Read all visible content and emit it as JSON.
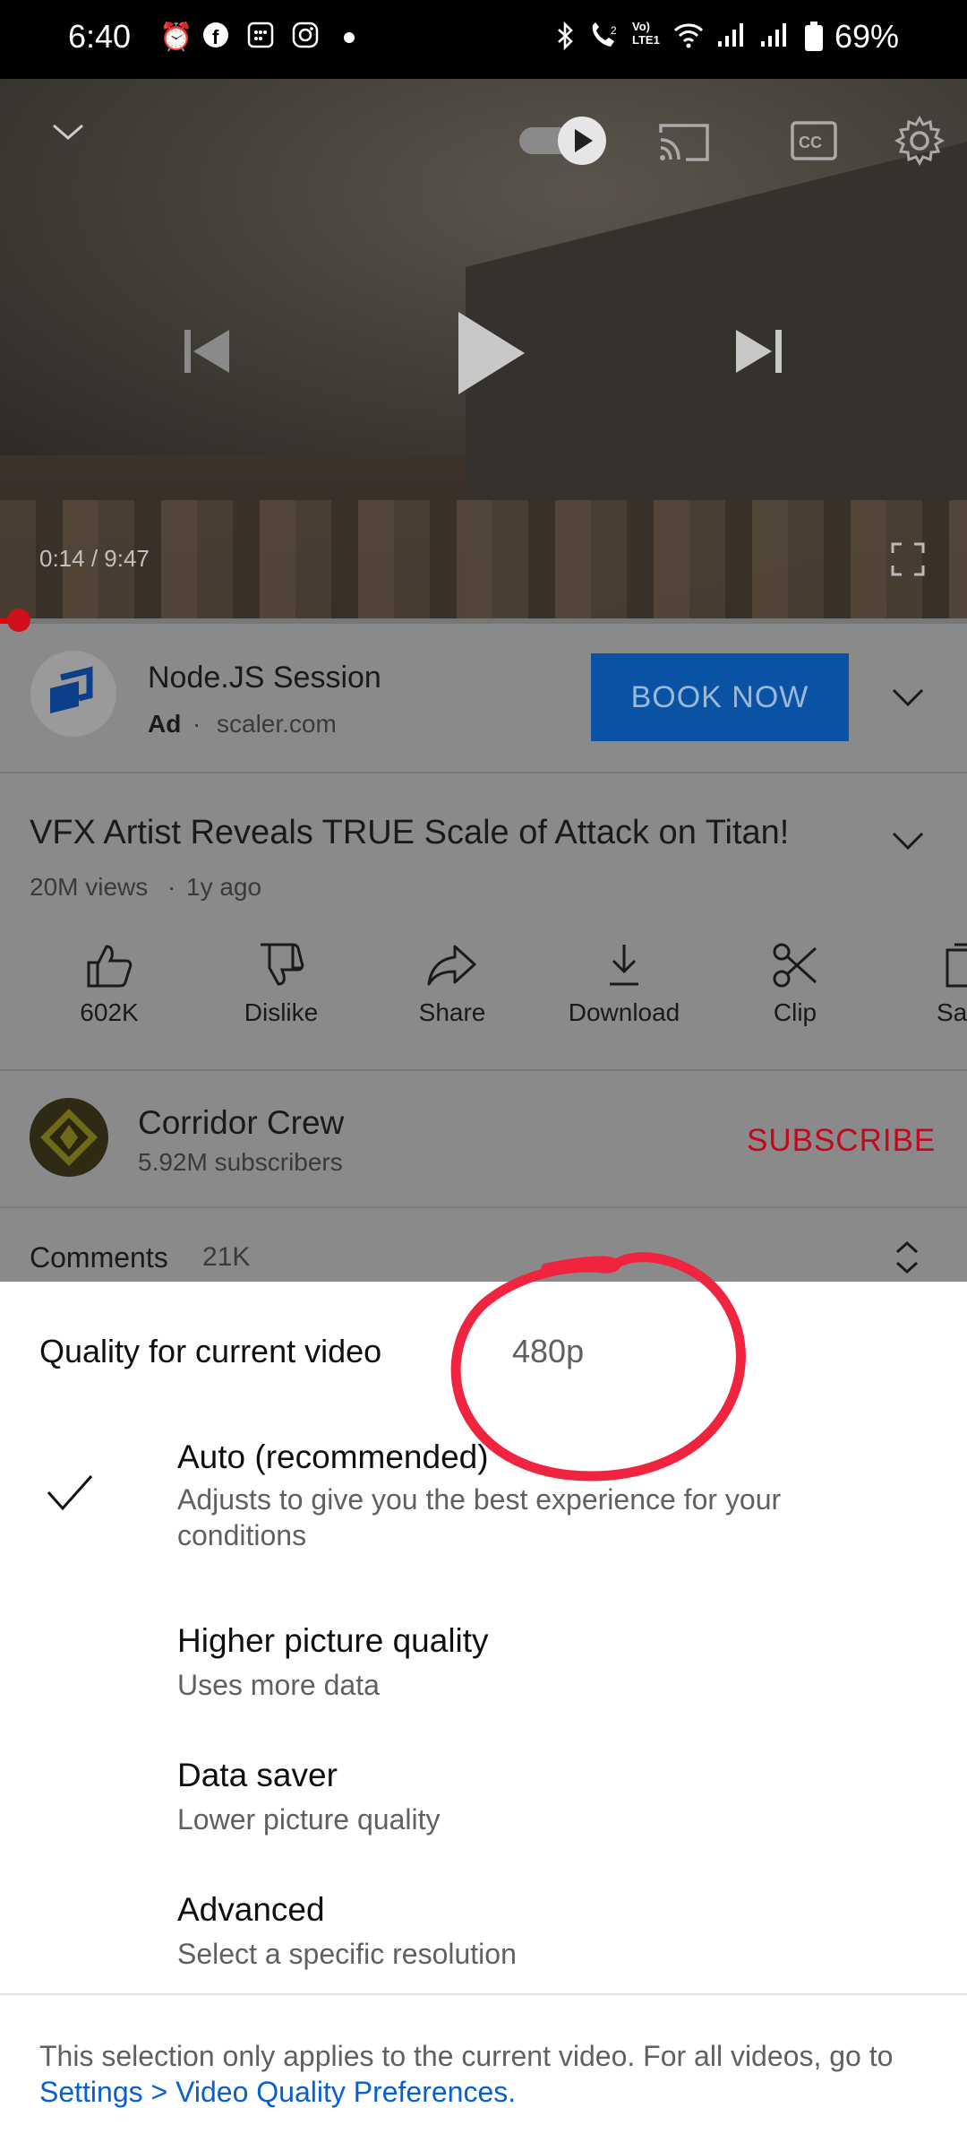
{
  "status_bar": {
    "time": "6:40",
    "battery": "69%",
    "left_icons": [
      "alarm-icon",
      "facebook-icon",
      "calendar-icon",
      "instagram-icon",
      "dot-icon"
    ],
    "right_icons": [
      "bluetooth-icon",
      "wifi-calling-icon",
      "volte-icon",
      "wifi-icon",
      "signal-icon",
      "signal-icon",
      "battery-icon"
    ]
  },
  "player": {
    "elapsed": "0:14",
    "duration": "9:47",
    "time_display": "0:14 / 9:47",
    "progress_fraction": 0.024,
    "autoplay_on": true
  },
  "ad": {
    "title": "Node.JS Session",
    "ad_label": "Ad",
    "domain": "scaler.com",
    "cta": "BOOK NOW"
  },
  "video": {
    "title": "VFX Artist Reveals TRUE Scale of Attack on Titan!",
    "views": "20M views",
    "age": "1y ago"
  },
  "actions": [
    {
      "label": "602K",
      "icon": "like-icon"
    },
    {
      "label": "Dislike",
      "icon": "dislike-icon"
    },
    {
      "label": "Share",
      "icon": "share-icon"
    },
    {
      "label": "Download",
      "icon": "download-icon"
    },
    {
      "label": "Clip",
      "icon": "clip-icon"
    },
    {
      "label": "Sa",
      "icon": "save-icon"
    }
  ],
  "channel": {
    "name": "Corridor Crew",
    "subscribers": "5.92M subscribers",
    "subscribe": "SUBSCRIBE"
  },
  "comments": {
    "label": "Comments",
    "count": "21K"
  },
  "quality_sheet": {
    "header": "Quality for current video",
    "current": "480p",
    "options": [
      {
        "title": "Auto (recommended)",
        "subtitle": "Adjusts to give you the best experience for your conditions",
        "selected": true
      },
      {
        "title": "Higher picture quality",
        "subtitle": "Uses more data",
        "selected": false
      },
      {
        "title": "Data saver",
        "subtitle": "Lower picture quality",
        "selected": false
      },
      {
        "title": "Advanced",
        "subtitle": "Select a specific resolution",
        "selected": false
      }
    ],
    "footer_text": "This selection only applies to the current video. For all videos, go to",
    "footer_link": "Settings > Video Quality Preferences.",
    "annotation_color": "#f0243f",
    "link_color": "#065fd4"
  },
  "colors": {
    "subscribe": "#c4061e",
    "book_now": "#0a52a3",
    "progress": "#d0101a"
  }
}
